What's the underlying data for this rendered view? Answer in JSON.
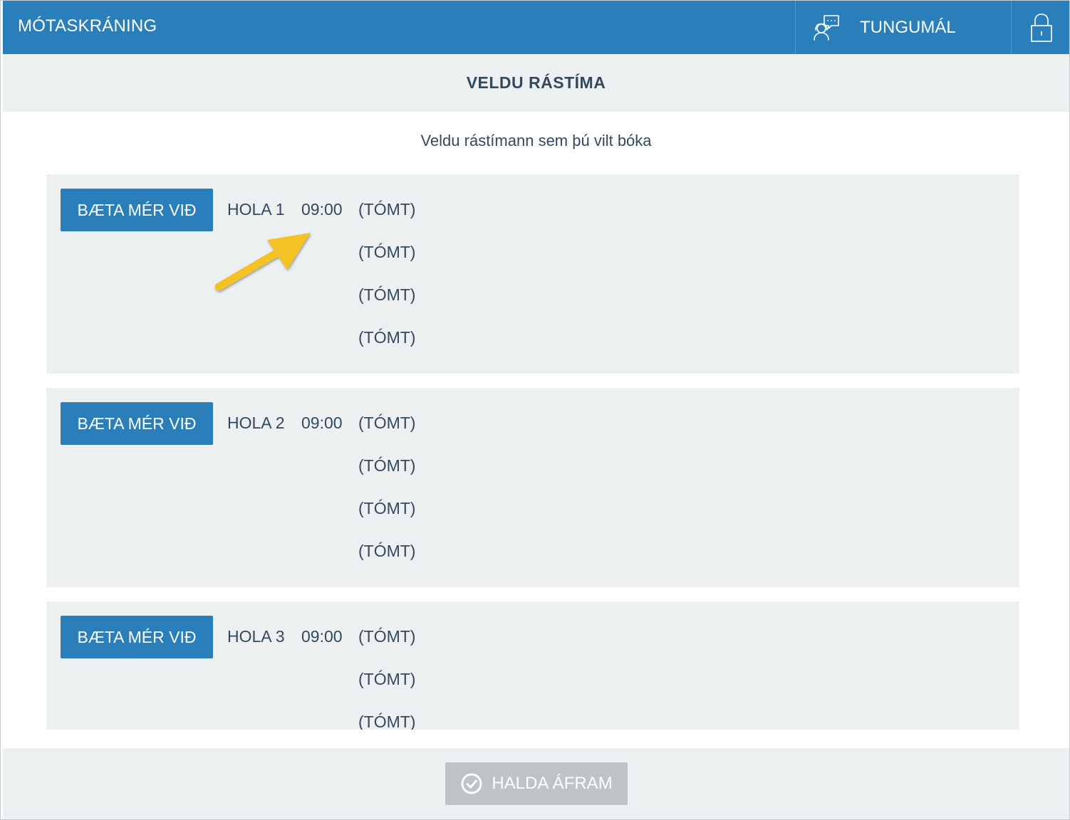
{
  "header": {
    "brand": "MÓTASKRÁNING",
    "language_label": "TUNGUMÁL"
  },
  "subheader": {
    "title": "VELDU RÁSTÍMA"
  },
  "instruction": "Veldu rástímann sem þú vilt bóka",
  "groups": [
    {
      "button_label": "BÆTA MÉR VIÐ",
      "hole": "HOLA 1",
      "time": "09:00",
      "slots": [
        "(TÓMT)",
        "(TÓMT)",
        "(TÓMT)",
        "(TÓMT)"
      ]
    },
    {
      "button_label": "BÆTA MÉR VIÐ",
      "hole": "HOLA 2",
      "time": "09:00",
      "slots": [
        "(TÓMT)",
        "(TÓMT)",
        "(TÓMT)",
        "(TÓMT)"
      ]
    },
    {
      "button_label": "BÆTA MÉR VIÐ",
      "hole": "HOLA 3",
      "time": "09:00",
      "slots": [
        "(TÓMT)",
        "(TÓMT)",
        "(TÓMT)"
      ]
    }
  ],
  "footer": {
    "continue_label": "HALDA ÁFRAM"
  },
  "icons": {
    "language": "language-chat-icon",
    "lock": "lock-icon",
    "continue": "check-circle-icon",
    "annotation": "arrow-icon"
  },
  "colors": {
    "primary": "#2a7fba",
    "panel": "#ecf0f1",
    "text": "#34495e",
    "disabled": "#bdc3c7",
    "annotation": "#f5c227"
  }
}
